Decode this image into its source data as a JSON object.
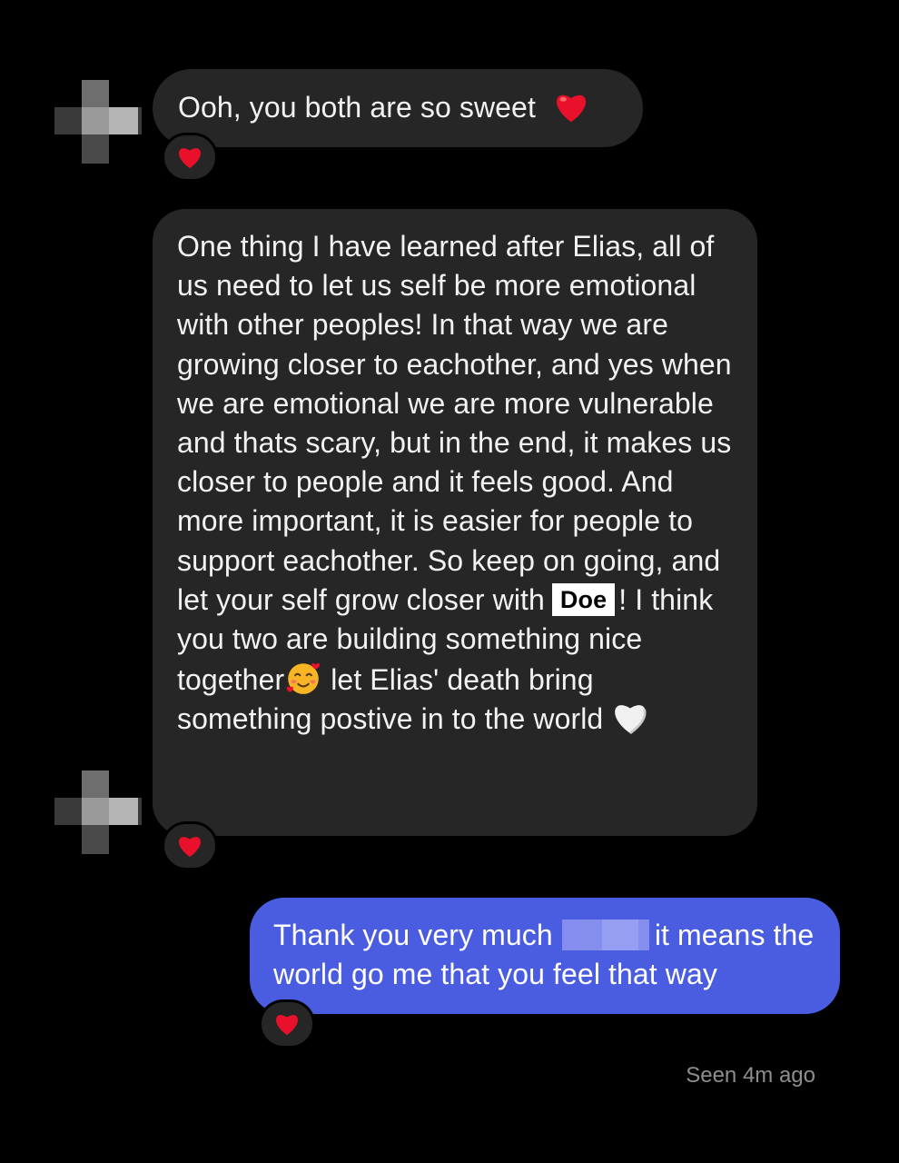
{
  "thread": {
    "messages": [
      {
        "sender": "other",
        "text": "Ooh, you both are so sweet",
        "trailing_emoji": "red-heart",
        "reaction": "red-heart"
      },
      {
        "sender": "other",
        "part1": "One thing I have learned after Elias, all of us need to let us self be more emotional with other peoples! In that way we are growing closer to eachother, and yes when we are emotional we are more vulnerable and thats scary, but in the end, it makes us closer to people and it feels good. And more important, it is easier for people to support eachother. So keep on going, and let your self grow closer with",
        "redacted_name": "Doe",
        "part2": "! I think you two are building something nice together",
        "emoji_mid": "smiling-face-with-hearts",
        "part3": " let Elias' death bring something postive in to the world ",
        "emoji_end": "white-heart",
        "reaction": "red-heart"
      },
      {
        "sender": "me",
        "part1": "Thank you very much",
        "part2": "it means the world go me that you feel that way",
        "reaction": "red-heart"
      }
    ],
    "seen_status": "Seen 4m ago"
  },
  "colors": {
    "background": "#000000",
    "incoming_bubble": "#262626",
    "outgoing_bubble": "#4a5ce0",
    "heart": "#e8102a",
    "seen_text": "#8e8e8e"
  }
}
